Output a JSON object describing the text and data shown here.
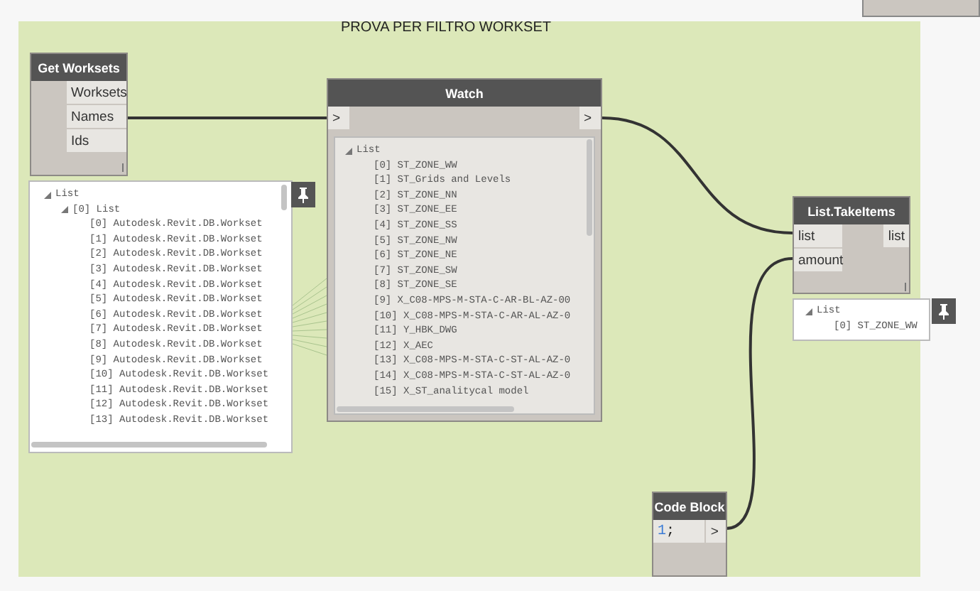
{
  "group": {
    "title": "PROVA PER FILTRO WORKSET"
  },
  "get_worksets": {
    "title": "Get Worksets",
    "outputs": [
      "Worksets",
      "Names",
      "Ids"
    ],
    "preview": {
      "label": "List",
      "expanded": true,
      "children": [
        {
          "label": "[0] List",
          "expanded": true,
          "children": [
            {
              "label": "[0] Autodesk.Revit.DB.Workset"
            },
            {
              "label": "[1] Autodesk.Revit.DB.Workset"
            },
            {
              "label": "[2] Autodesk.Revit.DB.Workset"
            },
            {
              "label": "[3] Autodesk.Revit.DB.Workset"
            },
            {
              "label": "[4] Autodesk.Revit.DB.Workset"
            },
            {
              "label": "[5] Autodesk.Revit.DB.Workset"
            },
            {
              "label": "[6] Autodesk.Revit.DB.Workset"
            },
            {
              "label": "[7] Autodesk.Revit.DB.Workset"
            },
            {
              "label": "[8] Autodesk.Revit.DB.Workset"
            },
            {
              "label": "[9] Autodesk.Revit.DB.Workset"
            },
            {
              "label": "[10] Autodesk.Revit.DB.Workset"
            },
            {
              "label": "[11] Autodesk.Revit.DB.Workset"
            },
            {
              "label": "[12] Autodesk.Revit.DB.Workset"
            },
            {
              "label": "[13] Autodesk.Revit.DB.Workset"
            }
          ]
        }
      ]
    }
  },
  "watch": {
    "title": "Watch",
    "input_port": ">",
    "output_port": ">",
    "list": {
      "label": "List",
      "expanded": true,
      "children": [
        {
          "label": "[0] ST_ZONE_WW"
        },
        {
          "label": "[1] ST_Grids and Levels"
        },
        {
          "label": "[2] ST_ZONE_NN"
        },
        {
          "label": "[3] ST_ZONE_EE"
        },
        {
          "label": "[4] ST_ZONE_SS"
        },
        {
          "label": "[5] ST_ZONE_NW"
        },
        {
          "label": "[6] ST_ZONE_NE"
        },
        {
          "label": "[7] ST_ZONE_SW"
        },
        {
          "label": "[8] ST_ZONE_SE"
        },
        {
          "label": "[9] X_C08-MPS-M-STA-C-AR-BL-AZ-00"
        },
        {
          "label": "[10] X_C08-MPS-M-STA-C-AR-AL-AZ-0"
        },
        {
          "label": "[11] Y_HBK_DWG"
        },
        {
          "label": "[12] X_AEC"
        },
        {
          "label": "[13] X_C08-MPS-M-STA-C-ST-AL-AZ-0"
        },
        {
          "label": "[14] X_C08-MPS-M-STA-C-ST-AL-AZ-0"
        },
        {
          "label": "[15] X_ST_analitycal model"
        }
      ]
    }
  },
  "take_items": {
    "title": "List.TakeItems",
    "inputs": [
      "list",
      "amount"
    ],
    "outputs": [
      "list"
    ],
    "preview": {
      "label": "List",
      "expanded": true,
      "children": [
        {
          "label": "[0] ST_ZONE_WW"
        }
      ]
    }
  },
  "code_block": {
    "title": "Code Block",
    "code": [
      {
        "text": "1",
        "kind": "number"
      },
      {
        "text": ";",
        "kind": "punctuation"
      }
    ],
    "output_port": ">"
  }
}
